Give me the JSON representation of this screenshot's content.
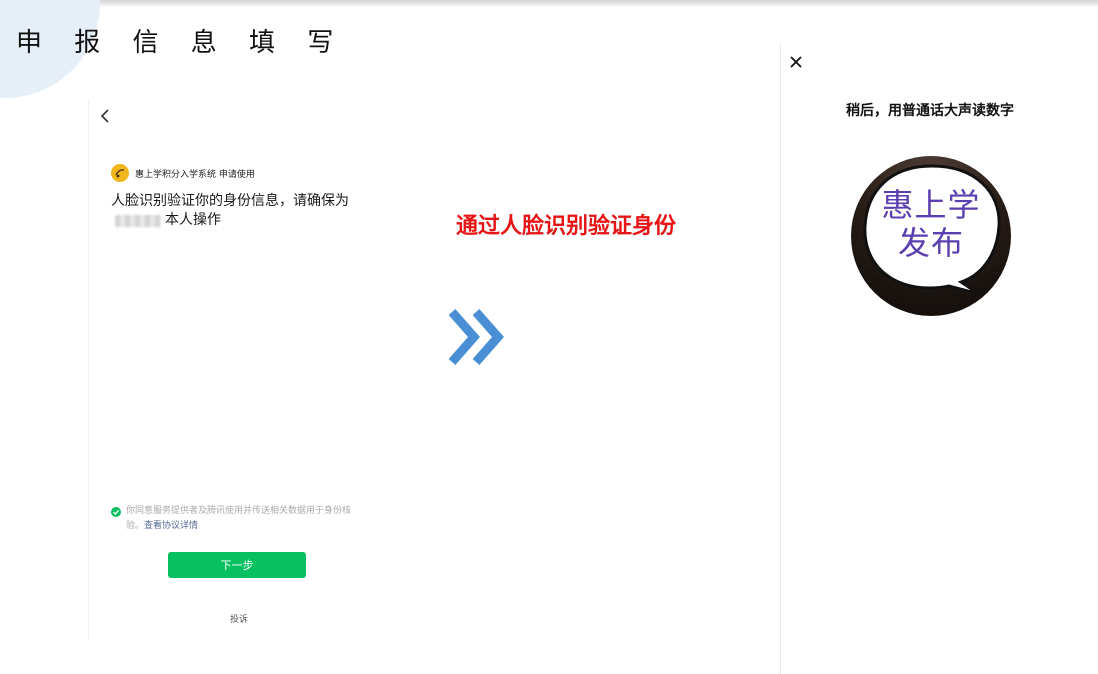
{
  "header": {
    "title": "申 报 信 息 填 写"
  },
  "left_panel": {
    "brand_text": "惠上学积分入学系统 申请使用",
    "description_part1": "人脸识别验证你的身份信息，请确保为",
    "description_part2": "本人操作",
    "agree_text": "你同意服务提供者及腾讯使用并传送相关数据用于身份核验。",
    "agree_link": "查看协议详情",
    "next_button": "下一步",
    "complain": "投诉"
  },
  "center": {
    "caption": "通过人脸识别验证身份"
  },
  "right_panel": {
    "instruction": "稍后，用普通话大声读数字",
    "watermark_line1": "惠上学",
    "watermark_line2": "发布"
  },
  "icons": {
    "back": "chevron-left-icon",
    "close": "close-icon",
    "check": "check-circle-icon",
    "arrow": "double-chevron-right-icon",
    "brand": "brand-logo-icon"
  },
  "colors": {
    "primary_green": "#07c160",
    "caption_red": "#e61414",
    "chevron_blue": "#4a8fd6",
    "link_blue": "#576b95",
    "watermark_purple": "#5b3fb0"
  }
}
